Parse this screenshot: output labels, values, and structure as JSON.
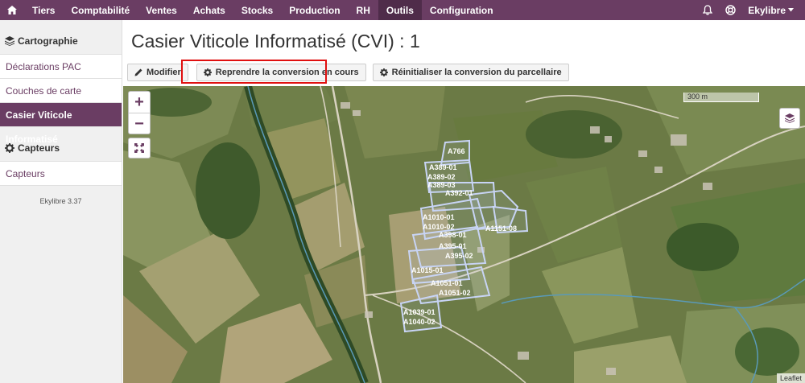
{
  "topbar": {
    "menu": [
      "Tiers",
      "Comptabilité",
      "Ventes",
      "Achats",
      "Stocks",
      "Production",
      "RH",
      "Outils",
      "Configuration"
    ],
    "active": "Outils",
    "user": "Ekylibre"
  },
  "sidebar": {
    "sections": [
      {
        "title": "Cartographie",
        "items": [
          "Déclarations PAC",
          "Couches de carte",
          "Casier Viticole Informatisé"
        ]
      },
      {
        "title": "Capteurs",
        "items": [
          "Capteurs"
        ]
      }
    ],
    "active_item": "Casier Viticole Informatisé",
    "version": "Ekylibre 3.37"
  },
  "page": {
    "title": "Casier Viticole Informatisé (CVI) : 1"
  },
  "toolbar": {
    "modify_label": "Modifier",
    "resume_label": "Reprendre la conversion en cours",
    "reset_label": "Réinitialiser la conversion du parcellaire"
  },
  "map": {
    "scale_label": "300 m",
    "attribution": "Leaflet",
    "zoom_in": "+",
    "zoom_out": "−",
    "parcel_labels": [
      "A766",
      "A389-01",
      "A389-02",
      "A389-03",
      "A392-01",
      "A1010-01",
      "A1010-02",
      "A398-01",
      "A395-01",
      "A395-02",
      "A1015-01",
      "A1051-01",
      "A1051-02",
      "A1039-01",
      "A1040-02",
      "A1151-08"
    ],
    "parcel_color": "#c8d4f5"
  }
}
